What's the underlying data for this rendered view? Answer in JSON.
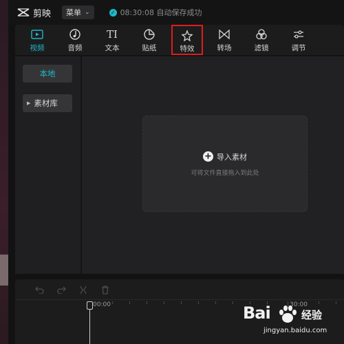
{
  "app": {
    "name": "剪映"
  },
  "topbar": {
    "menu_label": "菜单",
    "save_status": "08:30:08 自动保存成功"
  },
  "toolbar": {
    "items": [
      {
        "label": "视频",
        "icon": "video-icon",
        "active": true
      },
      {
        "label": "音频",
        "icon": "audio-icon"
      },
      {
        "label": "文本",
        "icon": "text-icon"
      },
      {
        "label": "贴纸",
        "icon": "sticker-icon"
      },
      {
        "label": "特效",
        "icon": "effects-icon",
        "highlighted": true
      },
      {
        "label": "转场",
        "icon": "transition-icon"
      },
      {
        "label": "滤镜",
        "icon": "filter-icon"
      },
      {
        "label": "调节",
        "icon": "adjust-icon"
      }
    ]
  },
  "media_panel": {
    "local_tab": "本地",
    "library_tab": "素材库"
  },
  "drop_zone": {
    "import_label": "导入素材",
    "hint": "可将文件直接拖入到此处"
  },
  "timeline": {
    "ticks": [
      "00:00",
      "30:00"
    ]
  },
  "colors": {
    "accent": "#1fb8c9",
    "highlight_box": "#e01c1c",
    "background": "#121213"
  },
  "watermark": {
    "brand": "Bai",
    "brand_cn": "经验",
    "url": "jingyan.baidu.com"
  }
}
